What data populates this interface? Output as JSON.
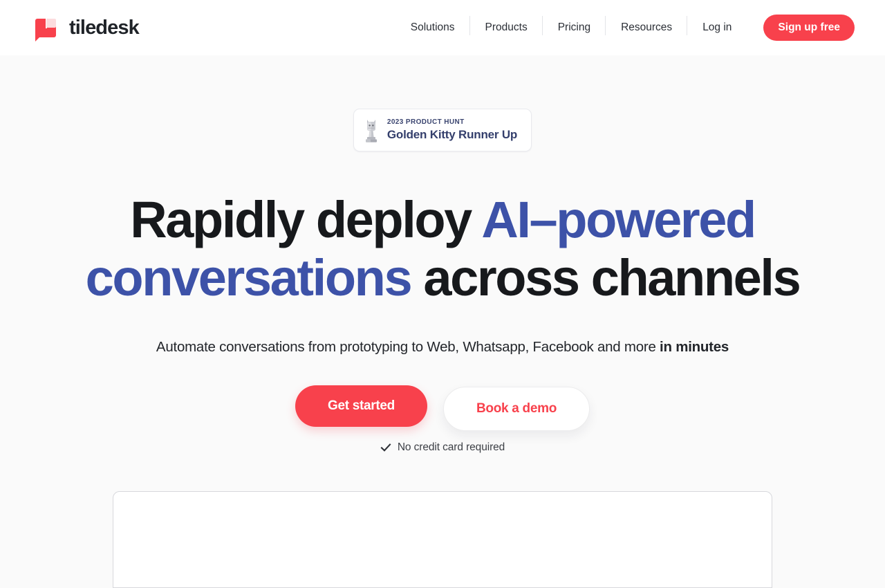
{
  "theme": {
    "brand_red": "#f8414c",
    "accent_blue": "#3d52a8",
    "navy": "#343f6c",
    "page_background": "#fafafa",
    "header_background": "#ffffff"
  },
  "header": {
    "logo_text": "tiledesk",
    "nav_items": [
      {
        "label": "Solutions"
      },
      {
        "label": "Products"
      },
      {
        "label": "Pricing"
      },
      {
        "label": "Resources"
      },
      {
        "label": "Log in"
      }
    ],
    "signup_label": "Sign up free"
  },
  "hero": {
    "badge": {
      "icon": "golden-kitty-trophy-icon",
      "eyebrow": "2023 PRODUCT HUNT",
      "title": "Golden Kitty Runner Up"
    },
    "headline": {
      "part1": "Rapidly deploy ",
      "accent1": "AI–powered",
      "part2": " ",
      "accent2": "conversations",
      "part3": " across channels"
    },
    "subheadline": {
      "text": "Automate conversations from prototyping to Web, Whatsapp, Facebook and more ",
      "bold": "in minutes"
    },
    "primary_cta": "Get started",
    "secondary_cta": "Book a demo",
    "note": {
      "icon": "check-icon",
      "text": "No credit card required"
    }
  }
}
